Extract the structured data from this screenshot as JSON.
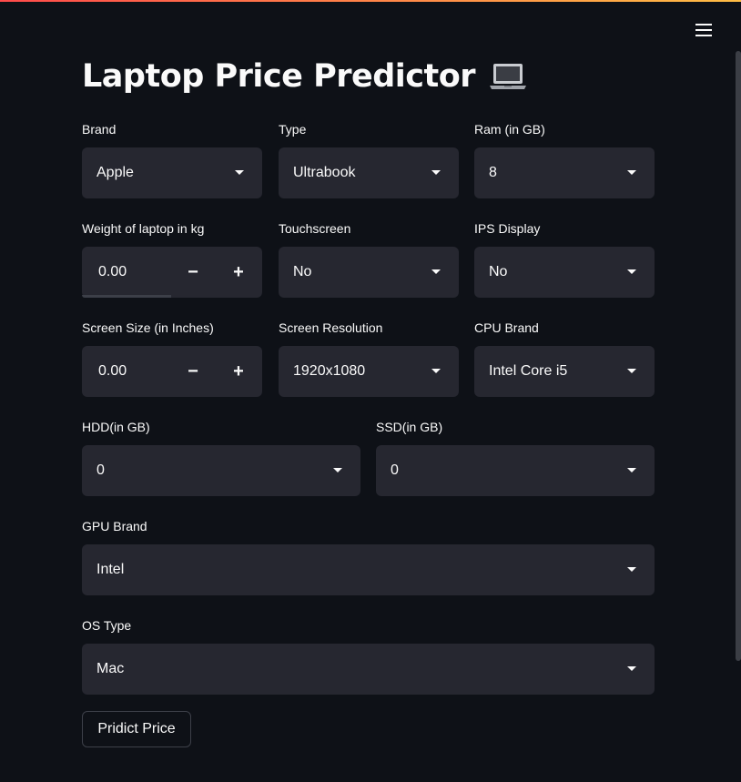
{
  "app": {
    "title": "Laptop Price Predictor",
    "title_icon": "laptop-icon"
  },
  "colors": {
    "background": "#0e1117",
    "input_bg": "#262730",
    "text": "#fafafa",
    "accent_gradient_start": "#ff4b4b",
    "accent_gradient_end": "#ffbd45"
  },
  "fields": {
    "brand": {
      "label": "Brand",
      "value": "Apple"
    },
    "type": {
      "label": "Type",
      "value": "Ultrabook"
    },
    "ram": {
      "label": "Ram (in GB)",
      "value": "8"
    },
    "weight": {
      "label": "Weight of laptop in kg",
      "value": "0.00",
      "minus": "−",
      "plus": "+"
    },
    "touchscreen": {
      "label": "Touchscreen",
      "value": "No"
    },
    "ips": {
      "label": "IPS Display",
      "value": "No"
    },
    "screen_size": {
      "label": "Screen Size (in Inches)",
      "value": "0.00",
      "minus": "−",
      "plus": "+"
    },
    "resolution": {
      "label": "Screen Resolution",
      "value": "1920x1080"
    },
    "cpu": {
      "label": "CPU Brand",
      "value": "Intel Core i5"
    },
    "hdd": {
      "label": "HDD(in GB)",
      "value": "0"
    },
    "ssd": {
      "label": "SSD(in GB)",
      "value": "0"
    },
    "gpu": {
      "label": "GPU Brand",
      "value": "Intel"
    },
    "os": {
      "label": "OS Type",
      "value": "Mac"
    }
  },
  "actions": {
    "predict_label": "Pridict Price"
  },
  "menu": {
    "icon": "hamburger-menu-icon"
  }
}
